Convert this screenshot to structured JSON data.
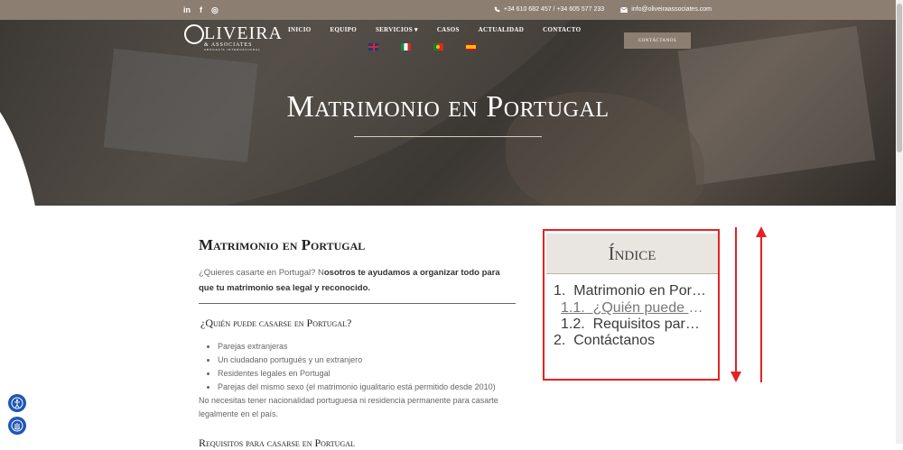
{
  "topbar": {
    "social": [
      "in",
      "f",
      "◎"
    ],
    "phone": "+34 610 682 457 / +34 605 577 233",
    "email": "info@oliveiraassociates.com"
  },
  "brand": {
    "name": "LIVEIRA",
    "sub": "& ASSOCIATES",
    "sub2": "ABOGACÍA INTERNACIONAL"
  },
  "nav": [
    {
      "label": "INICIO"
    },
    {
      "label": "EQUIPO"
    },
    {
      "label": "SERVICIOS"
    },
    {
      "label": "CASOS"
    },
    {
      "label": "ACTUALIDAD"
    },
    {
      "label": "CONTACTO"
    }
  ],
  "cta_label": "CONTÁCTANOS",
  "hero_title": "Matrimonio en Portugal",
  "article": {
    "title": "Matrimonio en Portugal",
    "intro_plain": "¿Quieres casarte en Portugal? N",
    "intro_bold": "osotros te ayudamos a organizar todo para que tu matrimonio sea legal y reconocido.",
    "section1_title": "¿Quién puede casarse en Portugal?",
    "list": [
      "Parejas extranjeras",
      "Un ciudadano portugués y un extranjero",
      "Residentes legales en Portugal",
      "Parejas del mismo sexo (el matrimonio igualitario está permitido desde 2010)"
    ],
    "note": "No necesitas tener nacionalidad portuguesa ni residencia permanente para casarte legalmente en el país.",
    "section2_title": "Requisitos para casarse en Portugal"
  },
  "toc": {
    "title": "Índice",
    "items": [
      {
        "num": "1.",
        "label": "Matrimonio en Portugal"
      },
      {
        "num": "1.1.",
        "label": "¿Quién puede casarse en Portugal?"
      },
      {
        "num": "1.2.",
        "label": "Requisitos para casarse en Portugal"
      },
      {
        "num": "2.",
        "label": "Contáctanos"
      }
    ]
  }
}
